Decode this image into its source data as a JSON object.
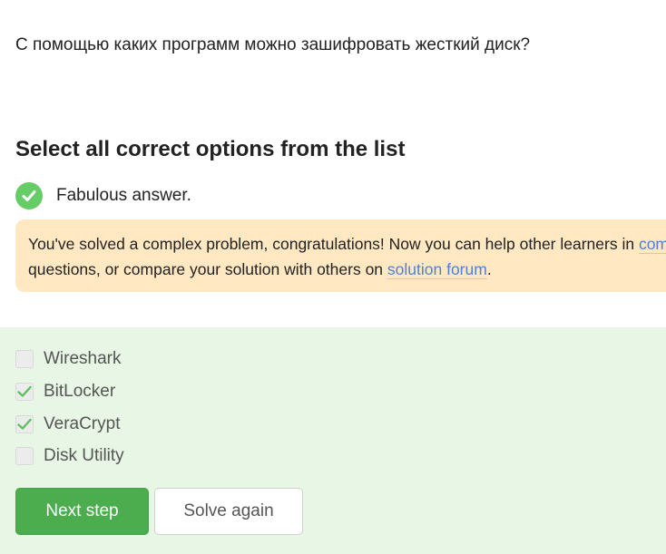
{
  "question": {
    "text": "С помощью каких программ можно зашифровать жесткий диск?"
  },
  "instruction": "Select all correct options from the list",
  "feedback": {
    "text": "Fabulous answer.",
    "icon": "check-circle-icon",
    "color": "#66cc66"
  },
  "notice": {
    "line1_text": "You've solved a complex problem, congratulations! Now you can help other learners in ",
    "line1_link": "com",
    "line2_text1": "questions, or compare your solution with others on ",
    "line2_link": "solution forum",
    "line2_text2": ".",
    "background": "#ffe8c2"
  },
  "options": [
    {
      "label": "Wireshark",
      "checked": false
    },
    {
      "label": "BitLocker",
      "checked": true
    },
    {
      "label": "VeraCrypt",
      "checked": true
    },
    {
      "label": "Disk Utility",
      "checked": false
    }
  ],
  "buttons": {
    "next_label": "Next step",
    "solve_again_label": "Solve again"
  },
  "colors": {
    "accent_green": "#4cad4f",
    "panel_bg": "#e8f6e5",
    "link": "#4e7fd9"
  }
}
